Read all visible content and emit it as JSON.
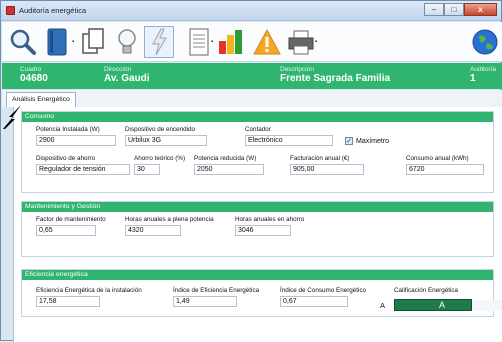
{
  "window": {
    "title": "Auditoría energética",
    "minimize": "–",
    "maximize": "□",
    "close": "x"
  },
  "toolbar": {
    "icons": [
      "search-icon",
      "book-icon",
      "copy-icon",
      "bulb-icon",
      "lightning-icon",
      "report-icon",
      "bar-chart-icon",
      "warning-icon",
      "printer-icon",
      "globe-icon"
    ]
  },
  "header": {
    "cuadro_label": "Cuadro",
    "cuadro_value": "04680",
    "direccion_label": "Dirección",
    "direccion_value": "Av. Gaudi",
    "descripcion_label": "Descripción",
    "descripcion_value": "Frente Sagrada Familia",
    "auditoria_label": "Auditoría",
    "auditoria_value": "1"
  },
  "tabs": {
    "active": "Análisis Energético"
  },
  "consumo": {
    "title": "Consumo",
    "potencia_label": "Potencia Instalada (W)",
    "potencia_value": "2900",
    "dispositivo_label": "Dispositivo de encendido",
    "dispositivo_value": "Urbilux 3G",
    "contador_label": "Contador",
    "contador_value": "Electrónico",
    "maximetro_label": "Maxímetro",
    "maximetro_checked": true,
    "ahorro_label": "Dispositivo de ahorro",
    "ahorro_value": "Regulador de tensión",
    "ahorro_teorico_label": "Ahorro teórico (%)",
    "ahorro_teorico_value": "30",
    "potencia_reducida_label": "Potencia reducida (W)",
    "potencia_reducida_value": "2050",
    "facturacion_label": "Facturación anual (€)",
    "facturacion_value": "905,00",
    "consumo_anual_label": "Consumo anual (kWh)",
    "consumo_anual_value": "6720"
  },
  "mantenimiento": {
    "title": "Mantenimiento y Gestión",
    "factor_label": "Factor de mantenimiento",
    "factor_value": "0,65",
    "horas_plena_label": "Horas anuales a plena potencia",
    "horas_plena_value": "4320",
    "horas_ahorro_label": "Horas anuales en ahorro",
    "horas_ahorro_value": "3046"
  },
  "eficiencia": {
    "title": "Eficiencia energética",
    "ef_instalacion_label": "Eficiencia Energética de la instalación",
    "ef_instalacion_value": "17,58",
    "indice_ef_label": "Índice de Eficiencia Energética",
    "indice_ef_value": "1,49",
    "indice_consumo_label": "Índice de Consumo Energético",
    "indice_consumo_value": "0,67",
    "calificacion_label": "Calificación Energética",
    "calificacion_value": "A",
    "calificacion_bar_label": "A",
    "calificacion_color": "#1e7a48"
  },
  "colors": {
    "accent": "#2fb56f",
    "titlebar": "#c3d6ee"
  }
}
